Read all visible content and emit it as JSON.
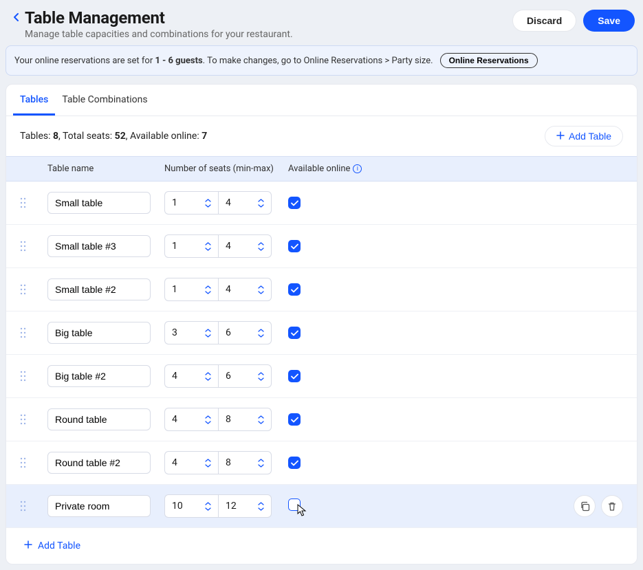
{
  "header": {
    "title": "Table Management",
    "subtitle": "Manage table capacities and combinations for your restaurant.",
    "discard_label": "Discard",
    "save_label": "Save"
  },
  "banner": {
    "text_prefix": "Your online reservations are set for ",
    "bold_range": "1 - 6 guests",
    "text_suffix": ". To make changes, go to Online Reservations > Party size.",
    "pill_label": "Online Reservations"
  },
  "tabs": {
    "tables": "Tables",
    "combos": "Table Combinations"
  },
  "summary": {
    "tables_label": "Tables: ",
    "tables_value": "8",
    "seats_label": ", Total seats: ",
    "seats_value": "52",
    "online_label": ", Available online: ",
    "online_value": "7",
    "add_label": "Add Table"
  },
  "columns": {
    "name": "Table name",
    "seats": "Number of seats (min-max)",
    "online": "Available online"
  },
  "rows": [
    {
      "name": "Small table",
      "min": "1",
      "max": "4",
      "online": true,
      "highlight": false
    },
    {
      "name": "Small table #3",
      "min": "1",
      "max": "4",
      "online": true,
      "highlight": false
    },
    {
      "name": "Small table #2",
      "min": "1",
      "max": "4",
      "online": true,
      "highlight": false
    },
    {
      "name": "Big table",
      "min": "3",
      "max": "6",
      "online": true,
      "highlight": false
    },
    {
      "name": "Big table #2",
      "min": "4",
      "max": "6",
      "online": true,
      "highlight": false
    },
    {
      "name": "Round table",
      "min": "4",
      "max": "8",
      "online": true,
      "highlight": false
    },
    {
      "name": "Round table #2",
      "min": "4",
      "max": "8",
      "online": true,
      "highlight": false
    },
    {
      "name": "Private room",
      "min": "10",
      "max": "12",
      "online": false,
      "highlight": true
    }
  ],
  "footer": {
    "add_label": "Add Table"
  }
}
